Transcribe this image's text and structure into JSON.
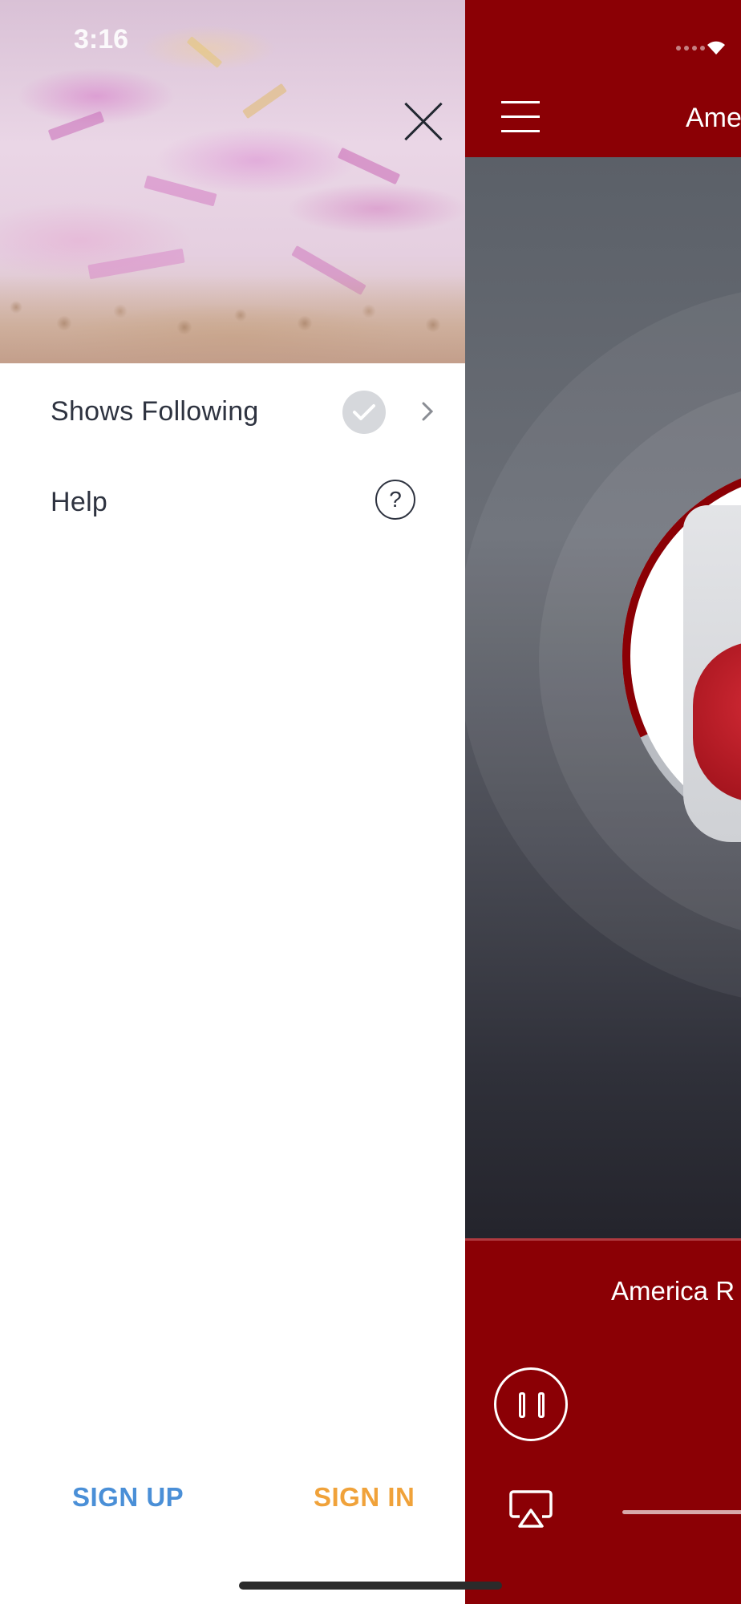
{
  "status_bar": {
    "time": "3:16"
  },
  "drawer": {
    "close_icon": "close-icon",
    "items": [
      {
        "label": "Shows Following",
        "icon": "checkmark-icon",
        "trailing_icon": "chevron-right-icon"
      },
      {
        "label": "Help",
        "icon": "question-mark-icon",
        "icon_glyph": "?"
      }
    ],
    "sign_up_label": "SIGN UP",
    "sign_in_label": "SIGN IN",
    "colors": {
      "sign_up": "#4a8fd7",
      "sign_in": "#f0a23a",
      "text": "#2e3340"
    }
  },
  "player": {
    "title": "Ame",
    "now_playing": "America R",
    "menu_icon": "hamburger-menu-icon",
    "pause_icon": "pause-icon",
    "airplay_icon": "airplay-icon",
    "colors": {
      "brand": "#8b0005"
    }
  }
}
